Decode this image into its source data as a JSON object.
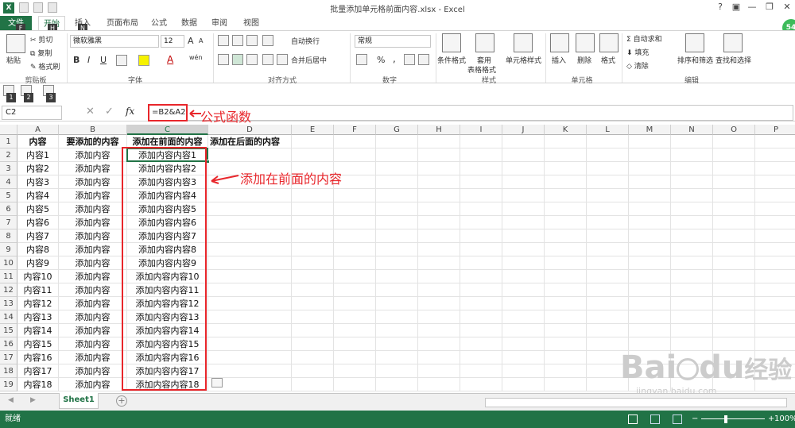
{
  "window": {
    "title": "批量添加单元格前面内容.xlsx - Excel",
    "logo": "X",
    "help": "?",
    "minimize": "—",
    "restore": "❐",
    "close": "✕"
  },
  "tabs": [
    {
      "label": "文件",
      "key": "F"
    },
    {
      "label": "开始",
      "key": "H"
    },
    {
      "label": "插入",
      "key": "N"
    },
    {
      "label": "页面布局"
    },
    {
      "label": "公式"
    },
    {
      "label": "数据"
    },
    {
      "label": "审阅"
    },
    {
      "label": "视图"
    }
  ],
  "user_badge": "54",
  "ribbon": {
    "clipboard": {
      "paste": "粘贴",
      "cut": "剪切",
      "copy": "复制",
      "format_painter": "格式刷",
      "label": "剪贴板"
    },
    "font": {
      "name": "微软雅黑",
      "size": "12",
      "grow": "A",
      "shrink": "A",
      "bold": "B",
      "italic": "I",
      "underline": "U",
      "color_a": "A",
      "wen": "wén",
      "label": "字体"
    },
    "alignment": {
      "wrap": "自动换行",
      "merge": "合并后居中",
      "label": "对齐方式"
    },
    "number": {
      "format": "常规",
      "percent": "%",
      "comma": ",",
      "label": "数字"
    },
    "styles": {
      "conditional": "条件格式",
      "table1": "套用",
      "table2": "表格格式",
      "cell_styles": "单元格样式",
      "label": "样式"
    },
    "cells": {
      "insert": "插入",
      "delete": "删除",
      "format": "格式",
      "label": "单元格"
    },
    "editing": {
      "autosum": "自动求和",
      "fill": "填充",
      "clear": "清除",
      "sort": "排序和筛选",
      "find": "查找和选择",
      "label": "编辑"
    }
  },
  "keytips_bar": [
    "1",
    "2",
    "3"
  ],
  "formula_bar": {
    "name_box": "C2",
    "fx": "fx",
    "cancel": "✕",
    "enter": "✓",
    "formula": "=B2&A2"
  },
  "columns": [
    "A",
    "B",
    "C",
    "D",
    "E",
    "F",
    "G",
    "H",
    "I",
    "J",
    "K",
    "L",
    "M",
    "N",
    "O",
    "P"
  ],
  "rows": [
    {
      "n": "1",
      "a": "内容",
      "b": "要添加的内容",
      "c": "添加在前面的内容",
      "d": "添加在后面的内容"
    },
    {
      "n": "2",
      "a": "内容1",
      "b": "添加内容",
      "c": "添加内容内容1",
      "d": ""
    },
    {
      "n": "3",
      "a": "内容2",
      "b": "添加内容",
      "c": "添加内容内容2",
      "d": ""
    },
    {
      "n": "4",
      "a": "内容3",
      "b": "添加内容",
      "c": "添加内容内容3",
      "d": ""
    },
    {
      "n": "5",
      "a": "内容4",
      "b": "添加内容",
      "c": "添加内容内容4",
      "d": ""
    },
    {
      "n": "6",
      "a": "内容5",
      "b": "添加内容",
      "c": "添加内容内容5",
      "d": ""
    },
    {
      "n": "7",
      "a": "内容6",
      "b": "添加内容",
      "c": "添加内容内容6",
      "d": ""
    },
    {
      "n": "8",
      "a": "内容7",
      "b": "添加内容",
      "c": "添加内容内容7",
      "d": ""
    },
    {
      "n": "9",
      "a": "内容8",
      "b": "添加内容",
      "c": "添加内容内容8",
      "d": ""
    },
    {
      "n": "10",
      "a": "内容9",
      "b": "添加内容",
      "c": "添加内容内容9",
      "d": ""
    },
    {
      "n": "11",
      "a": "内容10",
      "b": "添加内容",
      "c": "添加内容内容10",
      "d": ""
    },
    {
      "n": "12",
      "a": "内容11",
      "b": "添加内容",
      "c": "添加内容内容11",
      "d": ""
    },
    {
      "n": "13",
      "a": "内容12",
      "b": "添加内容",
      "c": "添加内容内容12",
      "d": ""
    },
    {
      "n": "14",
      "a": "内容13",
      "b": "添加内容",
      "c": "添加内容内容13",
      "d": ""
    },
    {
      "n": "15",
      "a": "内容14",
      "b": "添加内容",
      "c": "添加内容内容14",
      "d": ""
    },
    {
      "n": "16",
      "a": "内容15",
      "b": "添加内容",
      "c": "添加内容内容15",
      "d": ""
    },
    {
      "n": "17",
      "a": "内容16",
      "b": "添加内容",
      "c": "添加内容内容16",
      "d": ""
    },
    {
      "n": "18",
      "a": "内容17",
      "b": "添加内容",
      "c": "添加内容内容17",
      "d": ""
    },
    {
      "n": "19",
      "a": "内容18",
      "b": "添加内容",
      "c": "添加内容内容18",
      "d": ""
    }
  ],
  "annotations": {
    "formula_label": "公式函数",
    "range_label": "添加在前面的内容"
  },
  "sheets": [
    {
      "name": "Sheet1"
    }
  ],
  "sheet_nav": {
    "prev": "◀",
    "next": "▶",
    "add": "+"
  },
  "status": {
    "ready": "就绪",
    "zoom": "100%",
    "minus": "−",
    "plus": "+"
  },
  "watermark": {
    "brand": "Bai",
    "suffix": "du",
    "cn": "经验",
    "url": "jingyan.baidu.com"
  },
  "colors": {
    "excel_green": "#217346",
    "annotation_red": "#e8262b"
  }
}
